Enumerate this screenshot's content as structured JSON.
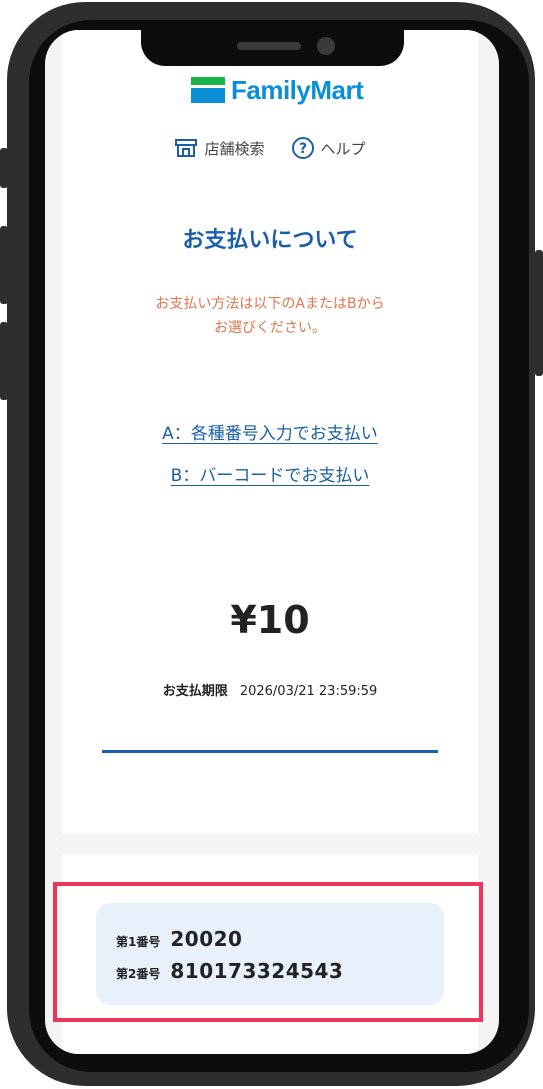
{
  "brand": {
    "name": "FamilyMart",
    "colors": {
      "green": "#1ab54a",
      "blue": "#0a8fd6"
    }
  },
  "nav": {
    "store_search": {
      "label": "店舗検索",
      "icon": "store-icon"
    },
    "help": {
      "label": "ヘルプ",
      "icon": "help-icon"
    }
  },
  "page": {
    "heading": "お支払いについて",
    "notice_line1": "お支払い方法は以下のAまたはBから",
    "notice_line2": "お選びください。",
    "option_a": "A：各種番号入力でお支払い",
    "option_b": "B：バーコードでお支払い",
    "amount": "¥10",
    "deadline_label": "お支払期限",
    "deadline_value": "2026/03/21 23:59:59"
  },
  "codes": {
    "first_label": "第1番号",
    "first_value": "20020",
    "second_label": "第2番号",
    "second_value": "810173324543"
  },
  "colors": {
    "accent_blue": "#1a5fa8",
    "notice_orange": "#e0764d",
    "highlight_red": "#e8365d",
    "card_bg": "#e8f0fc"
  }
}
